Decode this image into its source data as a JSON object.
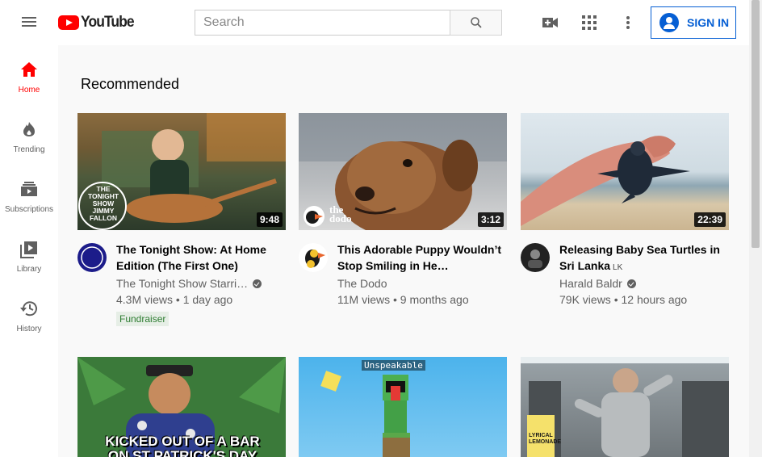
{
  "header": {
    "logo_text": "YouTube",
    "search_placeholder": "Search",
    "signin_label": "SIGN IN"
  },
  "guide": {
    "items": [
      {
        "label": "Home",
        "icon": "home-icon",
        "active": true
      },
      {
        "label": "Trending",
        "icon": "flame-icon",
        "active": false
      },
      {
        "label": "Subscriptions",
        "icon": "subscriptions-icon",
        "active": false
      },
      {
        "label": "Library",
        "icon": "library-icon",
        "active": false
      },
      {
        "label": "History",
        "icon": "history-icon",
        "active": false
      }
    ]
  },
  "main": {
    "section_title": "Recommended",
    "videos": [
      {
        "title": "The Tonight Show: At Home Edition (The First One)",
        "channel": "The Tonight Show Starri…",
        "verified": true,
        "stats": "4.3M views • 1 day ago",
        "badge": "Fundraiser",
        "duration": "9:48",
        "thumb_overlay": "THE TONIGHT SHOW JIMMY FALLON"
      },
      {
        "title": "This Adorable Puppy Wouldn’t Stop Smiling in He…",
        "channel": "The Dodo",
        "verified": false,
        "stats": "11M views • 9 months ago",
        "duration": "3:12",
        "thumb_overlay": "the dodo"
      },
      {
        "title": "Releasing Baby Sea Turtles in Sri Lanka",
        "title_tag": "LK",
        "channel": "Harald Baldr",
        "verified": true,
        "stats": "79K views • 12 hours ago",
        "duration": "22:39"
      },
      {
        "thumb_overlay": "KICKED OUT OF A BAR ON ST PATRICK'S DAY"
      },
      {
        "thumb_overlay": "Unspeakable"
      },
      {
        "thumb_overlay": "LYRICAL LEMONADE"
      }
    ]
  },
  "colors": {
    "brand_red": "#ff0000",
    "link_blue": "#065fd4",
    "fundraiser_green": "#2e7d32"
  }
}
